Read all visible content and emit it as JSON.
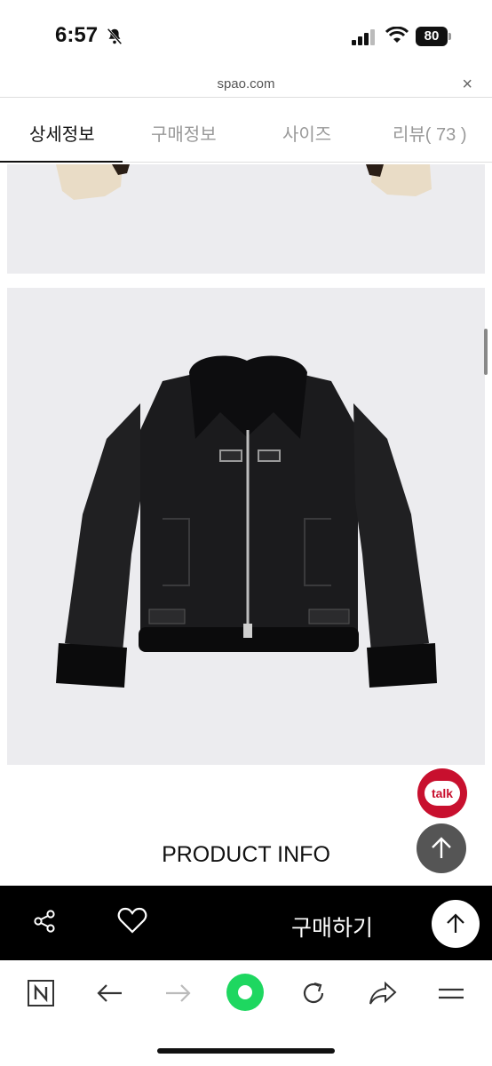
{
  "status": {
    "time": "6:57",
    "battery": "80"
  },
  "browser": {
    "url": "spao.com",
    "close": "×"
  },
  "tabs": [
    {
      "label": "상세정보",
      "active": true
    },
    {
      "label": "구매정보",
      "active": false
    },
    {
      "label": "사이즈",
      "active": false
    },
    {
      "label": "리뷰( 73 )",
      "active": false
    }
  ],
  "talk": {
    "label": "talk"
  },
  "section": {
    "title": "PRODUCT INFO"
  },
  "buybar": {
    "buy_label": "구매하기"
  },
  "icons": {
    "bell": "bell-slash-icon",
    "share": "share-icon",
    "heart": "heart-icon",
    "up": "arrow-up-icon"
  },
  "colors": {
    "talk": "#c8102e",
    "refresh": "#1ed760"
  }
}
